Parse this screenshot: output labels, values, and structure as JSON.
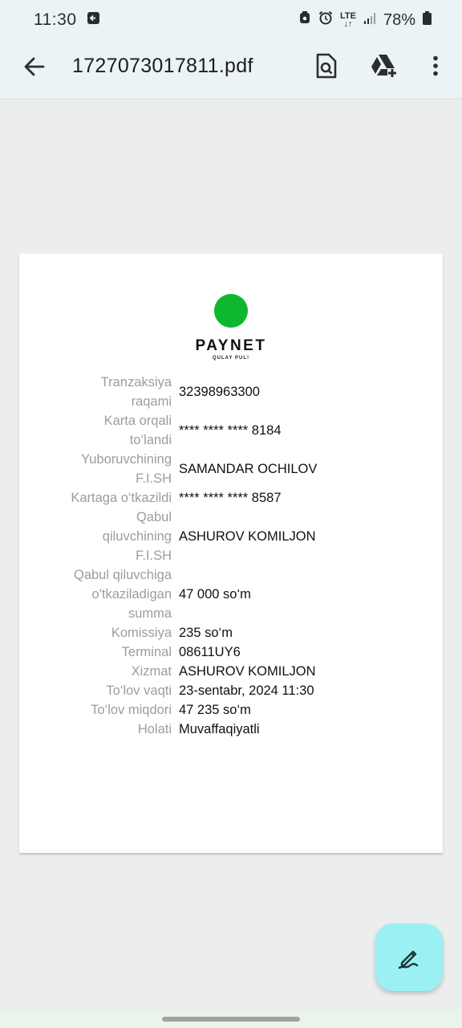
{
  "status_bar": {
    "time": "11:30",
    "lte": "LTE",
    "battery": "78%"
  },
  "app_bar": {
    "title": "1727073017811.pdf"
  },
  "receipt": {
    "brand": "PAYNET",
    "tagline": "QULAY PUL!",
    "brand_color": "#0fb72f",
    "fields": [
      {
        "label_lines": [
          "Tranzaksiya",
          "raqami"
        ],
        "value": "32398963300"
      },
      {
        "label_lines": [
          "Karta orqali",
          "to‘landi"
        ],
        "value": "**** **** **** 8184"
      },
      {
        "label_lines": [
          "Yuboruvchining",
          "F.I.SH"
        ],
        "value": "SAMANDAR OCHILOV"
      },
      {
        "label_lines": [
          "Kartaga o‘tkazildi"
        ],
        "value": "**** **** **** 8587"
      },
      {
        "label_lines": [
          "Qabul",
          "qiluvchining",
          "F.I.SH"
        ],
        "value": "ASHUROV KOMILJON"
      },
      {
        "label_lines": [
          "Qabul qiluvchiga",
          "o'tkaziladigan",
          "summa"
        ],
        "value": "47 000 so‘m"
      },
      {
        "label_lines": [
          "Komissiya"
        ],
        "value": "235 so‘m"
      },
      {
        "label_lines": [
          "Terminal"
        ],
        "value": "08611UY6"
      },
      {
        "label_lines": [
          "Xizmat"
        ],
        "value": "ASHUROV KOMILJON"
      },
      {
        "label_lines": [
          "To‘lov vaqti"
        ],
        "value": "23-sentabr, 2024 11:30"
      },
      {
        "label_lines": [
          "To‘lov miqdori"
        ],
        "value": "47 235 so‘m"
      },
      {
        "label_lines": [
          "Holati"
        ],
        "value": "Muvaffaqiyatli"
      }
    ]
  },
  "fab": {
    "icon": "edit-pen-icon",
    "color": "#9af0f2"
  }
}
